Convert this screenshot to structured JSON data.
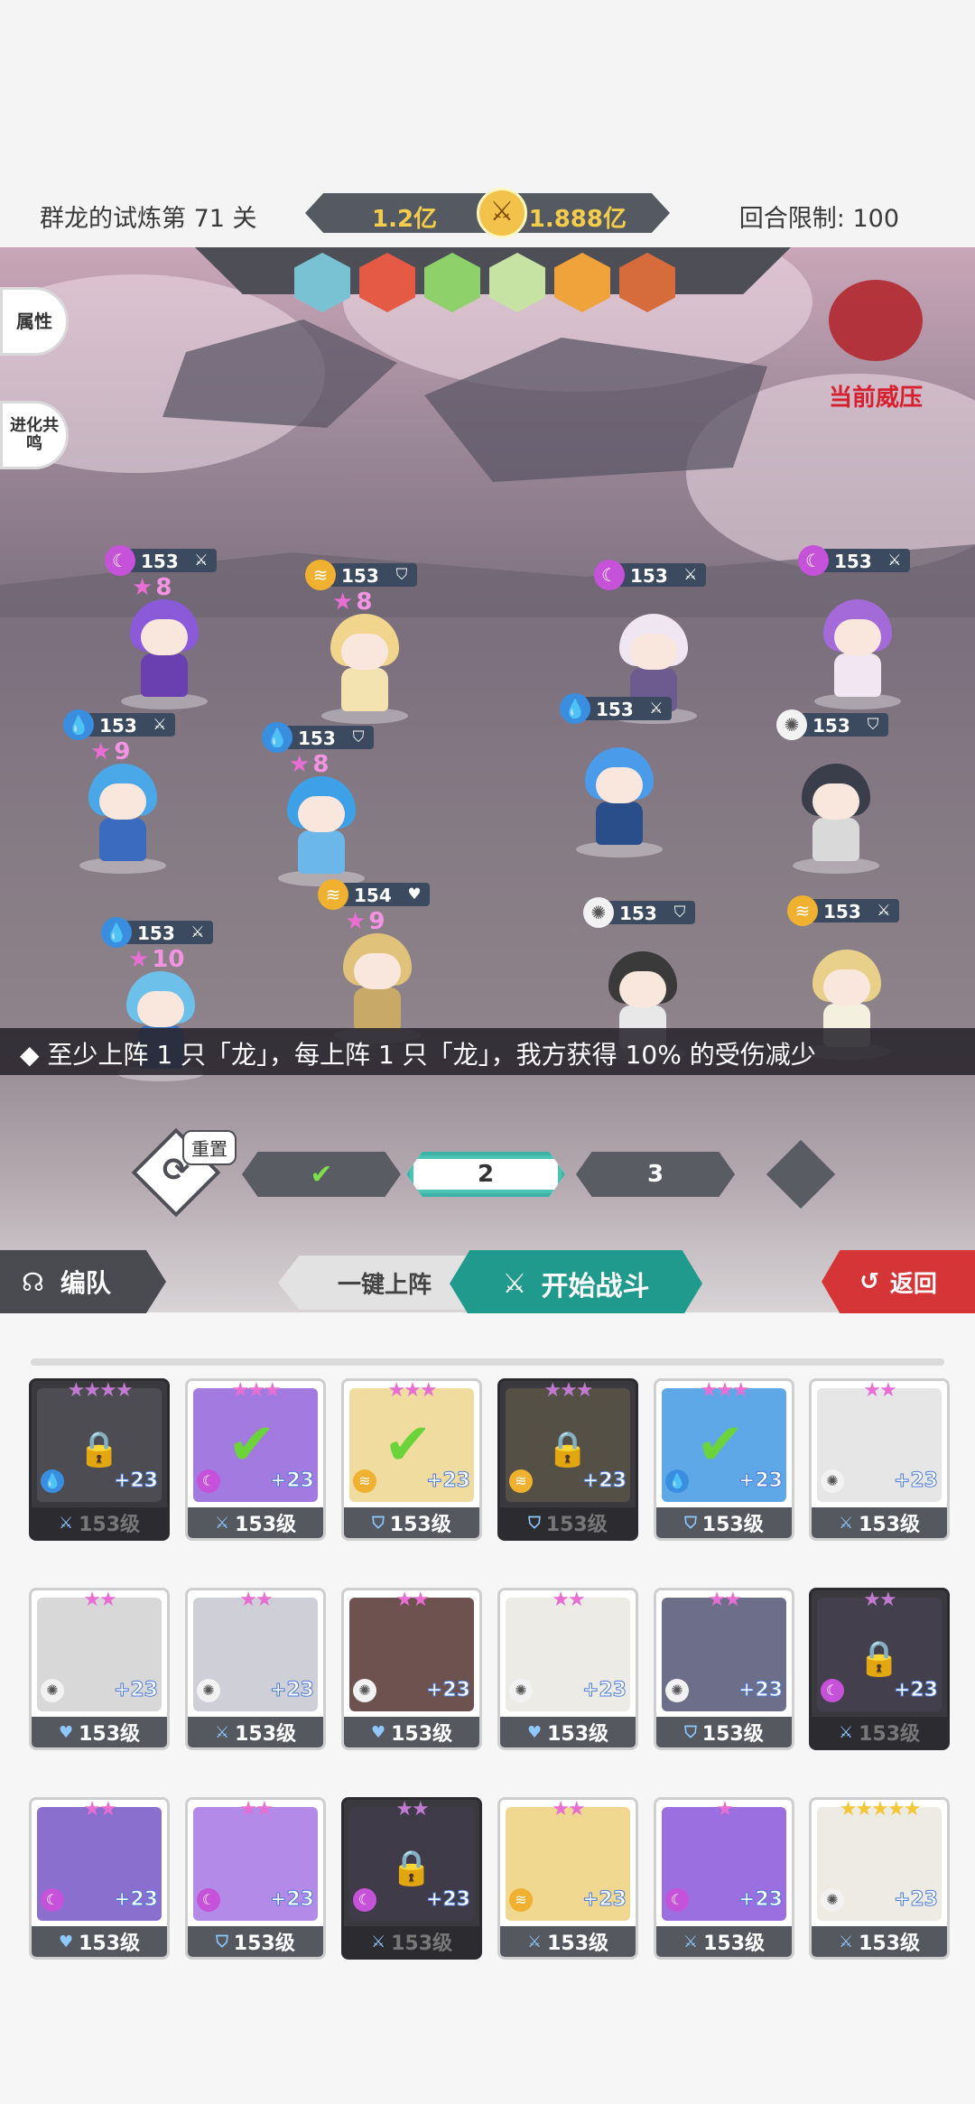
{
  "header": {
    "stage_title": "群龙的试炼第 71 关",
    "power_left": "1.2亿",
    "power_right": "1.888亿",
    "round_limit": "回合限制: 100"
  },
  "side_buttons": {
    "attributes": "属性",
    "evolution": "进化共鸣"
  },
  "dragon": {
    "label": "当前威压",
    "color": "#d81f2e"
  },
  "enemies": [
    {
      "color": "#79c2d3"
    },
    {
      "color": "#e45a45"
    },
    {
      "color": "#8ed16a"
    },
    {
      "color": "#c7e3a4"
    },
    {
      "color": "#f0a33a"
    },
    {
      "color": "#d66b3b"
    }
  ],
  "left_team": [
    {
      "level": "153",
      "stars": "8",
      "element": "moon",
      "role": "sword",
      "hair": "#8b5ad8",
      "body": "#6a3fb0"
    },
    {
      "level": "153",
      "stars": "8",
      "element": "storm",
      "role": "shield",
      "hair": "#f2d58c",
      "body": "#f3e3b0"
    },
    {
      "level": "153",
      "stars": "9",
      "element": "water",
      "role": "sword",
      "hair": "#4aa8e8",
      "body": "#3a6bbf"
    },
    {
      "level": "153",
      "stars": "8",
      "element": "water",
      "role": "shield",
      "hair": "#3ea0e6",
      "body": "#6bb7ea"
    },
    {
      "level": "154",
      "stars": "9",
      "element": "storm",
      "role": "heart",
      "hair": "#e0c27a",
      "body": "#c9a968"
    },
    {
      "level": "153",
      "stars": "10",
      "element": "water",
      "role": "sword",
      "hair": "#6cc0ea",
      "body": "#3b73c2"
    }
  ],
  "right_team": [
    {
      "level": "153",
      "element": "moon",
      "role": "sword",
      "hair": "#f0e6f2",
      "body": "#6d5a8f"
    },
    {
      "level": "153",
      "element": "moon",
      "role": "sword",
      "hair": "#a46ad8",
      "body": "#f2e6f2"
    },
    {
      "level": "153",
      "element": "water",
      "role": "sword",
      "hair": "#4a9cea",
      "body": "#2a4e8a"
    },
    {
      "level": "153",
      "element": "sun",
      "role": "shield",
      "hair": "#3a3d4a",
      "body": "#d9d9d9"
    },
    {
      "level": "153",
      "element": "sun",
      "role": "shield",
      "hair": "#3a3a3a",
      "body": "#e8e8e8"
    },
    {
      "level": "153",
      "element": "storm",
      "role": "sword",
      "hair": "#e9d08a",
      "body": "#f4f0e0"
    }
  ],
  "info_bar": "◆ 至少上阵 1 只「龙」，每上阵 1 只「龙」，我方获得 10% 的受伤减少",
  "waves": {
    "reset_label": "重置",
    "wave2": "2",
    "wave3": "3"
  },
  "actions": {
    "team_label": "编队",
    "auto_label": "一键上阵",
    "start_label": "开始战斗",
    "back_label": "返回"
  },
  "roster": [
    {
      "stars": "★★★★",
      "star_color": "#c07ad0",
      "plus": "+23",
      "level": "153级",
      "role": "sword",
      "element": "water",
      "color": "#6f6f78",
      "locked": true,
      "selected": false
    },
    {
      "stars": "★★★",
      "star_color": "#e86ed4",
      "plus": "+23",
      "level": "153级",
      "role": "sword",
      "element": "moon",
      "color": "#a37ae0",
      "locked": false,
      "selected": true
    },
    {
      "stars": "★★★",
      "star_color": "#e86ed4",
      "plus": "+23",
      "level": "153级",
      "role": "shield",
      "element": "storm",
      "color": "#f1dca0",
      "locked": false,
      "selected": true
    },
    {
      "stars": "★★★",
      "star_color": "#c07ad0",
      "plus": "+23",
      "level": "153级",
      "role": "shield",
      "element": "storm",
      "color": "#8a7a55",
      "locked": true,
      "selected": false
    },
    {
      "stars": "★★★",
      "star_color": "#e86ed4",
      "plus": "+23",
      "level": "153级",
      "role": "shield",
      "element": "water",
      "color": "#5fa8e8",
      "locked": false,
      "selected": true
    },
    {
      "stars": "★★",
      "star_color": "#e86ed4",
      "plus": "+23",
      "level": "153级",
      "role": "sword",
      "element": "sun",
      "color": "#e6e6e6",
      "locked": false,
      "selected": false
    },
    {
      "stars": "★★",
      "star_color": "#e86ed4",
      "plus": "+23",
      "level": "153级",
      "role": "heart",
      "element": "sun",
      "color": "#d8d8d8",
      "locked": false,
      "selected": false
    },
    {
      "stars": "★★",
      "star_color": "#e86ed4",
      "plus": "+23",
      "level": "153级",
      "role": "sword",
      "element": "sun",
      "color": "#cfcfd8",
      "locked": false,
      "selected": false
    },
    {
      "stars": "★★",
      "star_color": "#e86ed4",
      "plus": "+23",
      "level": "153级",
      "role": "heart",
      "element": "sun",
      "color": "#6e5250",
      "locked": false,
      "selected": false
    },
    {
      "stars": "★★",
      "star_color": "#e86ed4",
      "plus": "+23",
      "level": "153级",
      "role": "heart",
      "element": "sun",
      "color": "#ecebe6",
      "locked": false,
      "selected": false
    },
    {
      "stars": "★★",
      "star_color": "#e86ed4",
      "plus": "+23",
      "level": "153级",
      "role": "shield",
      "element": "sun",
      "color": "#6d6f8a",
      "locked": false,
      "selected": false
    },
    {
      "stars": "★★",
      "star_color": "#c07ad0",
      "plus": "+23",
      "level": "153级",
      "role": "sword",
      "element": "moon",
      "color": "#5a4a6a",
      "locked": true,
      "selected": false
    },
    {
      "stars": "★★",
      "star_color": "#e86ed4",
      "plus": "+23",
      "level": "153级",
      "role": "heart",
      "element": "moon",
      "color": "#8a6fcf",
      "locked": false,
      "selected": false
    },
    {
      "stars": "★★",
      "star_color": "#e86ed4",
      "plus": "+23",
      "level": "153级",
      "role": "shield",
      "element": "moon",
      "color": "#b48ae8",
      "locked": false,
      "selected": false
    },
    {
      "stars": "★★",
      "star_color": "#c07ad0",
      "plus": "+23",
      "level": "153级",
      "role": "sword",
      "element": "moon",
      "color": "#4e3e5e",
      "locked": true,
      "selected": false
    },
    {
      "stars": "★★",
      "star_color": "#e86ed4",
      "plus": "+23",
      "level": "153级",
      "role": "sword",
      "element": "storm",
      "color": "#f0d890",
      "locked": false,
      "selected": false
    },
    {
      "stars": "★",
      "star_color": "#e86ed4",
      "plus": "+23",
      "level": "153级",
      "role": "sword",
      "element": "moon",
      "color": "#9b6fe0",
      "locked": false,
      "selected": false
    },
    {
      "stars": "★★★★★",
      "star_color": "#f3c735",
      "plus": "+23",
      "level": "153级",
      "role": "sword",
      "element": "sun",
      "color": "#eeeae4",
      "locked": false,
      "selected": false
    }
  ]
}
